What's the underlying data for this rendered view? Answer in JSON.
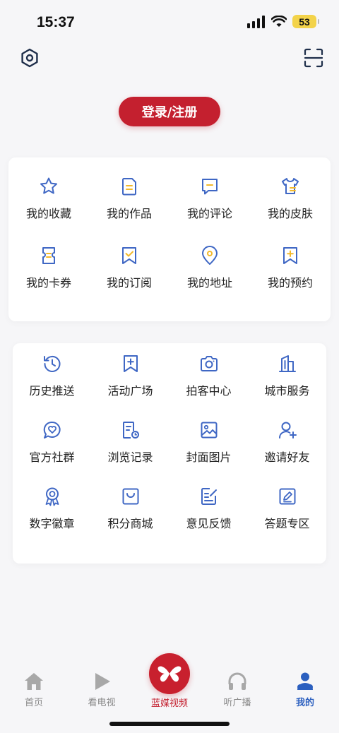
{
  "status_bar": {
    "time": "15:37",
    "battery": "53"
  },
  "header": {
    "login_label": "登录/注册"
  },
  "card1": {
    "items": [
      {
        "label": "我的收藏",
        "icon": "star-icon"
      },
      {
        "label": "我的作品",
        "icon": "document-icon"
      },
      {
        "label": "我的评论",
        "icon": "comment-icon"
      },
      {
        "label": "我的皮肤",
        "icon": "shirt-icon"
      },
      {
        "label": "我的卡券",
        "icon": "ticket-icon"
      },
      {
        "label": "我的订阅",
        "icon": "bookmark-check-icon"
      },
      {
        "label": "我的地址",
        "icon": "location-pin-icon"
      },
      {
        "label": "我的预约",
        "icon": "bookmark-plus-icon"
      }
    ]
  },
  "card2": {
    "items": [
      {
        "label": "历史推送",
        "icon": "history-icon"
      },
      {
        "label": "活动广场",
        "icon": "bookmark-add-icon"
      },
      {
        "label": "拍客中心",
        "icon": "camera-icon"
      },
      {
        "label": "城市服务",
        "icon": "building-icon"
      },
      {
        "label": "官方社群",
        "icon": "heart-chat-icon"
      },
      {
        "label": "浏览记录",
        "icon": "browse-record-icon"
      },
      {
        "label": "封面图片",
        "icon": "image-icon"
      },
      {
        "label": "邀请好友",
        "icon": "add-user-icon"
      },
      {
        "label": "数字徽章",
        "icon": "badge-icon"
      },
      {
        "label": "积分商城",
        "icon": "shopping-bag-icon"
      },
      {
        "label": "意见反馈",
        "icon": "feedback-icon"
      },
      {
        "label": "答题专区",
        "icon": "edit-icon"
      }
    ]
  },
  "tabbar": {
    "tabs": [
      {
        "label": "首页",
        "icon": "home-icon"
      },
      {
        "label": "看电视",
        "icon": "play-icon"
      },
      {
        "label": "蓝媒视频",
        "icon": "butterfly-logo-icon"
      },
      {
        "label": "听广播",
        "icon": "headphones-icon"
      },
      {
        "label": "我的",
        "icon": "user-icon"
      }
    ]
  },
  "colors": {
    "accent_blue": "#3f67c4",
    "accent_yellow": "#f2b92c",
    "brand_red": "#c4202f",
    "active_tab": "#2b5fbf"
  }
}
